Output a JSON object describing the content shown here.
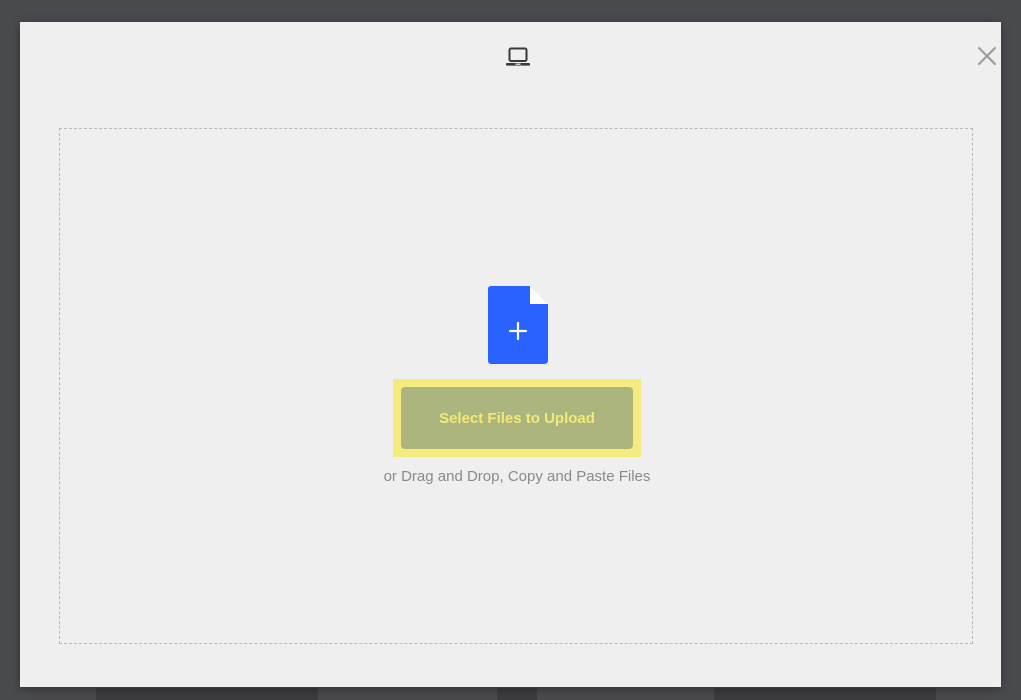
{
  "icons": {
    "source": "laptop-icon",
    "close": "close-icon",
    "file": "file-add-icon"
  },
  "upload": {
    "select_label": "Select Files to Upload",
    "hint": "or Drag and Drop, Copy and Paste Files"
  },
  "colors": {
    "backdrop": "#4a4b4f",
    "modal_bg": "#efefef",
    "file_icon": "#2962ff",
    "highlight": "#f5ec7f",
    "button_bg": "#acb57d",
    "button_text": "#f4ea78",
    "hint_text": "#8a8a8a"
  }
}
